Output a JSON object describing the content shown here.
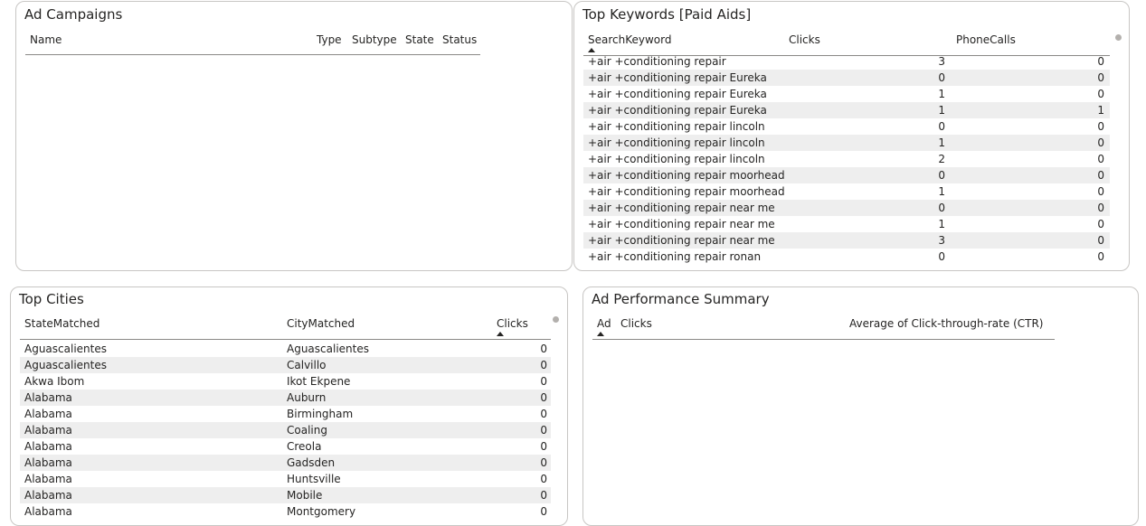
{
  "ad_campaigns": {
    "title": "Ad Campaigns",
    "columns": [
      "Name",
      "Type",
      "Subtype",
      "State",
      "Status"
    ]
  },
  "top_keywords": {
    "title": "Top Keywords [Paid Aids]",
    "columns": [
      "SearchKeyword",
      "Clicks",
      "PhoneCalls"
    ],
    "rows": [
      [
        "+air +conditioning repair",
        "3",
        "0"
      ],
      [
        "+air +conditioning repair Eureka",
        "0",
        "0"
      ],
      [
        "+air +conditioning repair Eureka",
        "1",
        "0"
      ],
      [
        "+air +conditioning repair Eureka",
        "1",
        "1"
      ],
      [
        "+air +conditioning repair lincoln",
        "0",
        "0"
      ],
      [
        "+air +conditioning repair lincoln",
        "1",
        "0"
      ],
      [
        "+air +conditioning repair lincoln",
        "2",
        "0"
      ],
      [
        "+air +conditioning repair moorhead",
        "0",
        "0"
      ],
      [
        "+air +conditioning repair moorhead",
        "1",
        "0"
      ],
      [
        "+air +conditioning repair near me",
        "0",
        "0"
      ],
      [
        "+air +conditioning repair near me",
        "1",
        "0"
      ],
      [
        "+air +conditioning repair near me",
        "3",
        "0"
      ],
      [
        "+air +conditioning repair ronan",
        "0",
        "0"
      ]
    ]
  },
  "top_cities": {
    "title": "Top Cities",
    "columns": [
      "StateMatched",
      "CityMatched",
      "Clicks"
    ],
    "rows": [
      [
        "Aguascalientes",
        "Aguascalientes",
        "0"
      ],
      [
        "Aguascalientes",
        "Calvillo",
        "0"
      ],
      [
        "Akwa Ibom",
        "Ikot Ekpene",
        "0"
      ],
      [
        "Alabama",
        "Auburn",
        "0"
      ],
      [
        "Alabama",
        "Birmingham",
        "0"
      ],
      [
        "Alabama",
        "Coaling",
        "0"
      ],
      [
        "Alabama",
        "Creola",
        "0"
      ],
      [
        "Alabama",
        "Gadsden",
        "0"
      ],
      [
        "Alabama",
        "Huntsville",
        "0"
      ],
      [
        "Alabama",
        "Mobile",
        "0"
      ],
      [
        "Alabama",
        "Montgomery",
        "0"
      ]
    ]
  },
  "ad_performance": {
    "title": "Ad Performance Summary",
    "columns": [
      "Ad",
      "Clicks",
      "Average of Click-through-rate (CTR)"
    ]
  }
}
